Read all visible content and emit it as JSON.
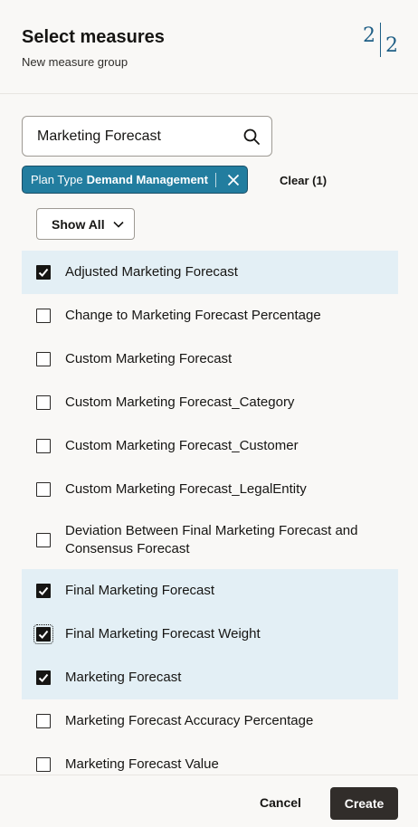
{
  "header": {
    "title": "Select measures",
    "subtitle": "New measure group",
    "step_current": "2",
    "step_total": "2"
  },
  "search": {
    "value": "Marketing Forecast",
    "icon": "search-icon"
  },
  "filter_chip": {
    "label": "Plan Type",
    "value": "Demand Management",
    "icon": "close-icon"
  },
  "clear_label": "Clear (1)",
  "show_all": {
    "label": "Show All",
    "icon": "chevron-down-icon"
  },
  "measures": [
    {
      "label": "Adjusted Marketing Forecast",
      "checked": true
    },
    {
      "label": "Change to Marketing Forecast Percentage",
      "checked": false
    },
    {
      "label": "Custom Marketing Forecast",
      "checked": false
    },
    {
      "label": "Custom Marketing Forecast_Category",
      "checked": false
    },
    {
      "label": "Custom Marketing Forecast_Customer",
      "checked": false
    },
    {
      "label": "Custom Marketing Forecast_LegalEntity",
      "checked": false
    },
    {
      "label": "Deviation Between Final Marketing Forecast and Consensus Forecast",
      "checked": false
    },
    {
      "label": "Final Marketing Forecast",
      "checked": true
    },
    {
      "label": "Final Marketing Forecast Weight",
      "checked": true
    },
    {
      "label": "Marketing Forecast",
      "checked": true
    },
    {
      "label": "Marketing Forecast Accuracy Percentage",
      "checked": false
    },
    {
      "label": "Marketing Forecast Value",
      "checked": false
    }
  ],
  "footer": {
    "cancel_label": "Cancel",
    "create_label": "Create"
  },
  "colors": {
    "accent": "#227d9f",
    "selected_row": "#e3eff5",
    "primary_button": "#312d2a",
    "step_indicator": "#1f5f86"
  }
}
